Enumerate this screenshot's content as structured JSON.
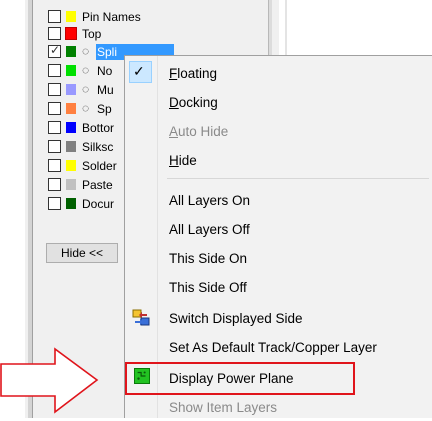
{
  "layer_panel": {
    "rows": [
      {
        "label": "Pin Names",
        "checked": false,
        "color": "#ffff00",
        "has_dots": false
      },
      {
        "label": "Top",
        "checked": false,
        "color": "#ff0000",
        "has_dots": false
      },
      {
        "label": "Spli",
        "checked": true,
        "color": "#008000",
        "has_dots": true,
        "selected": true
      },
      {
        "label": "No",
        "checked": false,
        "color": "#00e000",
        "has_dots": true
      },
      {
        "label": "Mu",
        "checked": false,
        "color": "#9999ff",
        "has_dots": true
      },
      {
        "label": "Sp",
        "checked": false,
        "color": "#ff8040",
        "has_dots": true
      },
      {
        "label": "Bottor",
        "checked": false,
        "color": "#0000ff",
        "has_dots": false
      },
      {
        "label": "Silksc",
        "checked": false,
        "color": "#808080",
        "has_dots": false
      },
      {
        "label": "Solder",
        "checked": false,
        "color": "#ffff00",
        "has_dots": false
      },
      {
        "label": "Paste",
        "checked": false,
        "color": "#c0c0c0",
        "has_dots": false
      },
      {
        "label": "Docur",
        "checked": false,
        "color": "#006000",
        "has_dots": false
      }
    ],
    "hide_button": "Hide <<"
  },
  "context_menu": {
    "floating": {
      "pre": "",
      "u": "F",
      "post": "loating"
    },
    "docking": {
      "pre": "",
      "u": "D",
      "post": "ocking"
    },
    "auto_hide": {
      "pre": "",
      "u": "A",
      "post": "uto Hide"
    },
    "hide": {
      "pre": "",
      "u": "H",
      "post": "ide"
    },
    "all_layers_on": "All Layers On",
    "all_layers_off": "All Layers Off",
    "this_side_on": "This Side On",
    "this_side_off": "This Side Off",
    "switch_displayed_side": "Switch Displayed Side",
    "set_default_layer": "Set As Default Track/Copper Layer",
    "display_power_plane": "Display Power Plane",
    "show_item_layers": "Show Item Layers"
  },
  "colors": {
    "selection": "#3399ff",
    "highlight_box": "#e0141b",
    "arrow": "#e0141b",
    "check_bg": "#cce8ff"
  },
  "icons": {
    "check": "checkmark-icon",
    "switch_side": "switch-side-icon",
    "power_plane": "power-plane-icon",
    "callout": "callout-arrow-icon"
  }
}
